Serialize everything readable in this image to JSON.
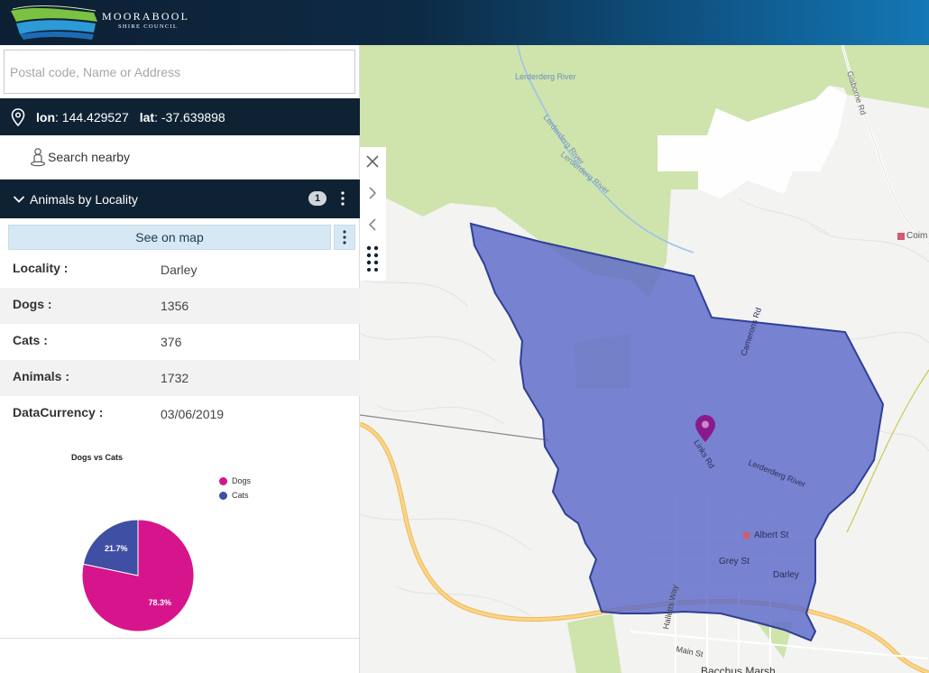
{
  "header": {
    "brand": "MOORABOOL",
    "brand_sub": "SHIRE COUNCIL"
  },
  "search": {
    "placeholder": "Postal code, Name or Address",
    "value": ""
  },
  "coords": {
    "lon_label": "lon",
    "lon_value": "144.429527",
    "lat_label": "lat",
    "lat_value": "-37.639898"
  },
  "nearby": {
    "label": "Search nearby"
  },
  "layer": {
    "title": "Animals by Locality",
    "count": "1"
  },
  "see_on_map": "See on map",
  "attributes": [
    {
      "key": "Locality :",
      "value": "Darley"
    },
    {
      "key": "Dogs :",
      "value": "1356"
    },
    {
      "key": "Cats :",
      "value": "376"
    },
    {
      "key": "Animals :",
      "value": "1732"
    },
    {
      "key": "DataCurrency :",
      "value": "03/06/2019"
    }
  ],
  "chart_data": {
    "type": "pie",
    "title": "Dogs vs Cats",
    "categories": [
      "Dogs",
      "Cats"
    ],
    "values": [
      78.3,
      21.7
    ],
    "labels": [
      "78.3%",
      "21.7%"
    ],
    "colors": [
      "#d6158c",
      "#3f4fa4"
    ],
    "legend_position": "right"
  },
  "map": {
    "labels": [
      "Lerderderg River",
      "Lerderderg River",
      "Lerderderg River",
      "Gisborne Rd",
      "Coim",
      "Camerons Rd",
      "Links Rd",
      "Lerderderg River",
      "Albert St",
      "Grey St",
      "Darley",
      "Halletts Way",
      "Main St",
      "Bacchus Marsh"
    ],
    "colors": {
      "highlight": "#5c69c8",
      "highlight_stroke": "#2f3f96",
      "forest": "#cfe3ad",
      "road_major": "#f7c46a",
      "pin": "#8a1a8c"
    }
  }
}
